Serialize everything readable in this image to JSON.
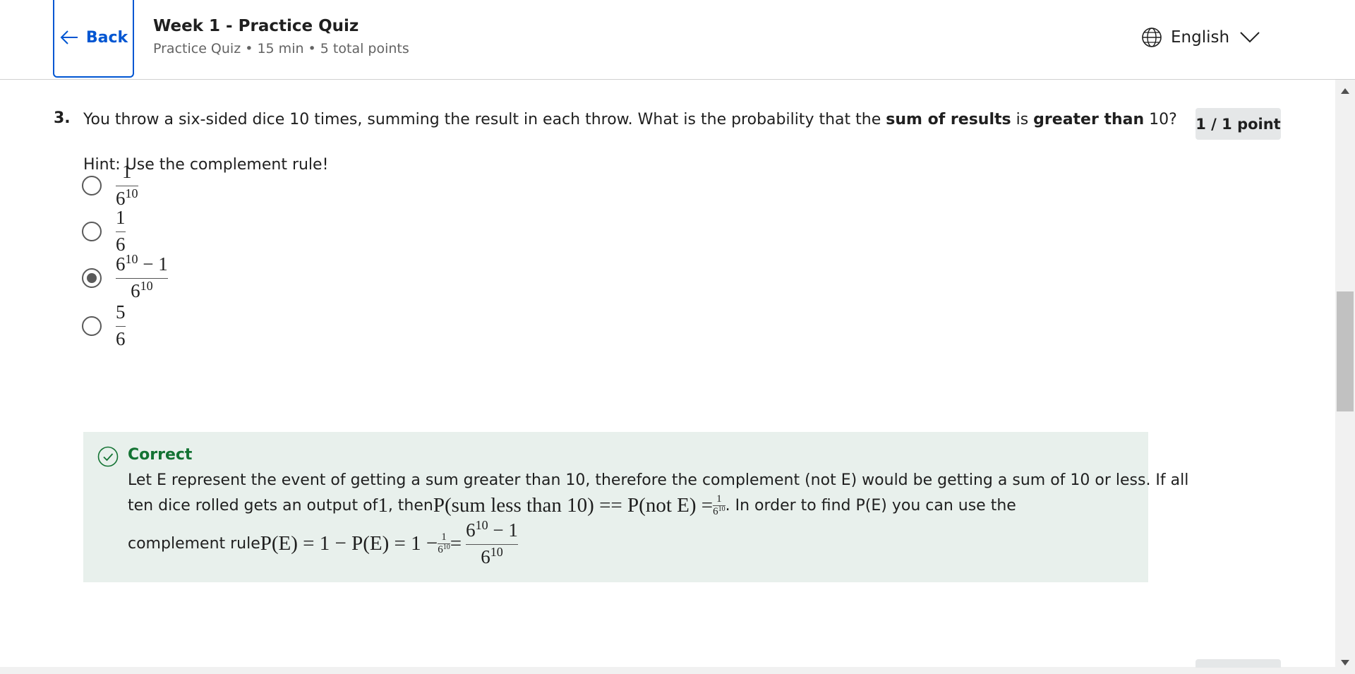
{
  "header": {
    "back_label": "Back",
    "title": "Week 1 - Practice Quiz",
    "subtitle": "Practice Quiz • 15 min • 5 total points",
    "language": "English"
  },
  "question": {
    "number": "3.",
    "text_pre": "You throw a six-sided dice 10 times, summing the result in each throw. What is the probability that the ",
    "bold1": "sum of results",
    "text_mid": " is ",
    "bold2": "greater than",
    "text_post": " 10?",
    "points": "1 / 1 point",
    "hint": "Hint: Use the complement rule!"
  },
  "options": [
    {
      "num": "1",
      "den": "6",
      "den_sup": "10",
      "selected": false
    },
    {
      "num": "1",
      "den": "6",
      "selected": false
    },
    {
      "num": "6",
      "num_sup": "10",
      "num_tail": " − 1",
      "den": "6",
      "den_sup": "10",
      "selected": true
    },
    {
      "num": "5",
      "den": "6",
      "selected": false
    }
  ],
  "feedback": {
    "status": "Correct",
    "line1": "Let E represent the event of getting a sum greater than 10, therefore the complement (not E) would be getting a sum of 10 or less. If all",
    "line2_pre": "ten dice rolled gets an output of ",
    "line2_one": "1",
    "line2_then": ", then ",
    "line2_math": "P(sum less than 10) == P(not E) = ",
    "line2_post": ". In order to find P(E) you can use the",
    "line3_pre": "complement rule ",
    "line3_math": "P(E) = 1 − P(E) = 1 − ",
    "line3_eq": " = "
  }
}
